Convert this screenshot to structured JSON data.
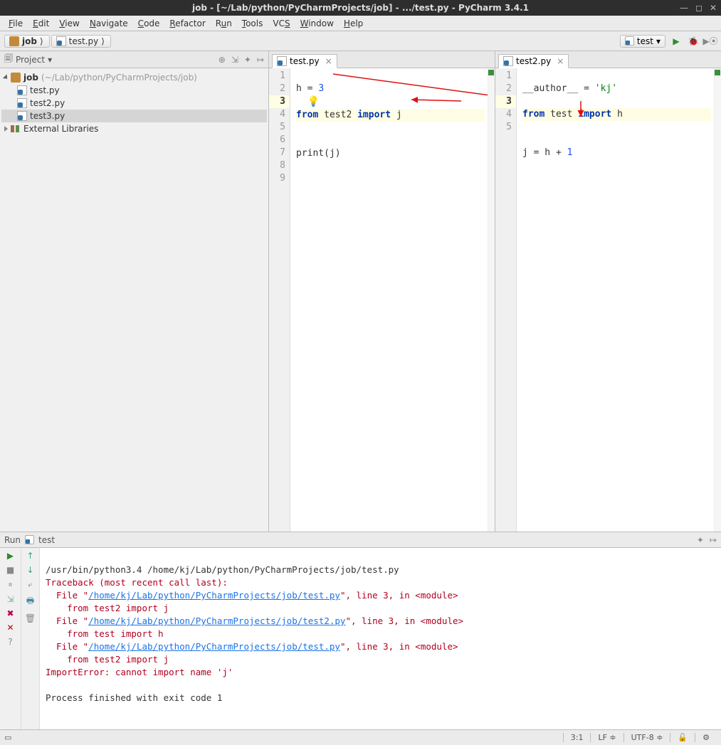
{
  "title": "job - [~/Lab/python/PyCharmProjects/job] - .../test.py - PyCharm 3.4.1",
  "menu": [
    "File",
    "Edit",
    "View",
    "Navigate",
    "Code",
    "Refactor",
    "Run",
    "Tools",
    "VCS",
    "Window",
    "Help"
  ],
  "breadcrumbs": {
    "project": "job",
    "file": "test.py"
  },
  "run_config": "test",
  "sidebar": {
    "title": "Project",
    "proj_name": "job",
    "proj_path": "(~/Lab/python/PyCharmProjects/job)",
    "files": [
      "test.py",
      "test2.py",
      "test3.py"
    ],
    "ext_lib": "External Libraries"
  },
  "editor1": {
    "tab": "test.py",
    "line_count": 9,
    "current_line": 3,
    "code": {
      "l1": {
        "pre": "h = ",
        "num": "3"
      },
      "l3": {
        "kw1": "from ",
        "m": "test2 ",
        "kw2": "import ",
        "v": "j"
      },
      "l5": {
        "pre": "print(j)"
      }
    }
  },
  "editor2": {
    "tab": "test2.py",
    "line_count": 5,
    "current_line": 3,
    "code": {
      "l1": {
        "pre": "__author__ = ",
        "str": "'kj'"
      },
      "l3": {
        "kw1": "from ",
        "m": "test ",
        "kw2": "import ",
        "v": "h"
      },
      "l5": {
        "pre": "j = h + ",
        "num": "1"
      }
    }
  },
  "run": {
    "title_pre": "Run",
    "title_cfg": "test",
    "cmd": "/usr/bin/python3.4 /home/kj/Lab/python/PyCharmProjects/job/test.py",
    "tb_head": "Traceback (most recent call last):",
    "f1_pre": "  File \"",
    "f1_link": "/home/kj/Lab/python/PyCharmProjects/job/test.py",
    "f1_post": "\", line 3, in <module>",
    "f1_src": "    from test2 import j",
    "f2_link": "/home/kj/Lab/python/PyCharmProjects/job/test2.py",
    "f2_post": "\", line 3, in <module>",
    "f2_src": "    from test import h",
    "f3_link": "/home/kj/Lab/python/PyCharmProjects/job/test.py",
    "f3_post": "\", line 3, in <module>",
    "f3_src": "    from test2 import j",
    "err_msg": "ImportError: cannot import name 'j'",
    "exit": "Process finished with exit code 1"
  },
  "status": {
    "pos": "3:1",
    "le": "LF",
    "enc": "UTF-8",
    "lock": "🔓"
  }
}
